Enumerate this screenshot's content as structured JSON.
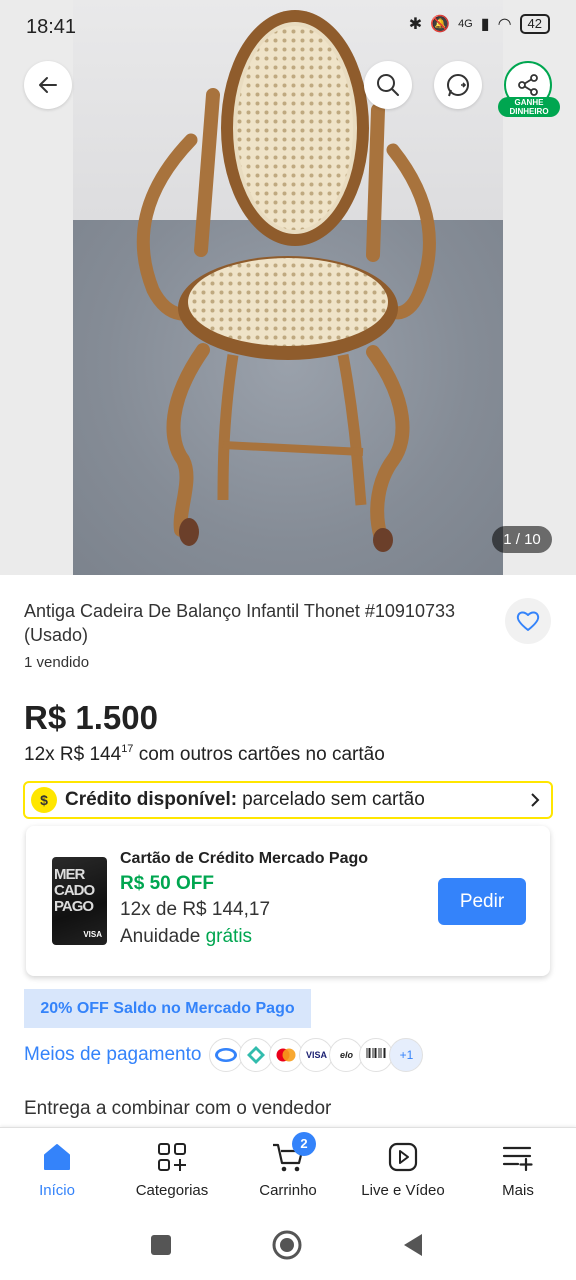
{
  "status_bar": {
    "time": "18:41",
    "network": "4G",
    "battery": "42"
  },
  "gallery": {
    "counter": "1 / 10"
  },
  "share": {
    "badge_line1": "GANHE",
    "badge_line2": "DINHEIRO"
  },
  "product": {
    "title": "Antiga Cadeira De Balanço Infantil Thonet #10910733 (Usado)",
    "sold": "1 vendido",
    "price": "R$ 1.500",
    "installment_prefix": "12x R$ 144",
    "installment_cents": "17",
    "installment_suffix": " com outros cartões no cartão"
  },
  "credit": {
    "label": "Crédito disponível:",
    "text": "parcelado sem cartão",
    "coin": "$"
  },
  "mp_card": {
    "card_text": "MER CADO PAGO",
    "card_brand": "VISA",
    "title": "Cartão de Crédito Mercado Pago",
    "discount": "R$ 50 OFF",
    "installment": "12x de R$ 144,17",
    "annual_prefix": "Anuidade ",
    "annual_value": "grátis",
    "button": "Pedir"
  },
  "promo": "20% OFF Saldo no Mercado Pago",
  "payment": {
    "link": "Meios de pagamento",
    "methods": [
      "mercadopago",
      "pix",
      "mastercard",
      "VISA",
      "elo",
      "Boleto"
    ],
    "more": "+1"
  },
  "delivery": "Entrega a combinar com o vendedor",
  "bottom_nav": {
    "items": [
      {
        "label": "Início",
        "icon": "home-icon"
      },
      {
        "label": "Categorias",
        "icon": "categories-icon"
      },
      {
        "label": "Carrinho",
        "icon": "cart-icon",
        "badge": "2"
      },
      {
        "label": "Live e Vídeo",
        "icon": "play-icon"
      },
      {
        "label": "Mais",
        "icon": "menu-plus-icon"
      }
    ]
  },
  "colors": {
    "accent": "#3483fa",
    "green": "#00a650",
    "yellow": "#ffe600"
  }
}
